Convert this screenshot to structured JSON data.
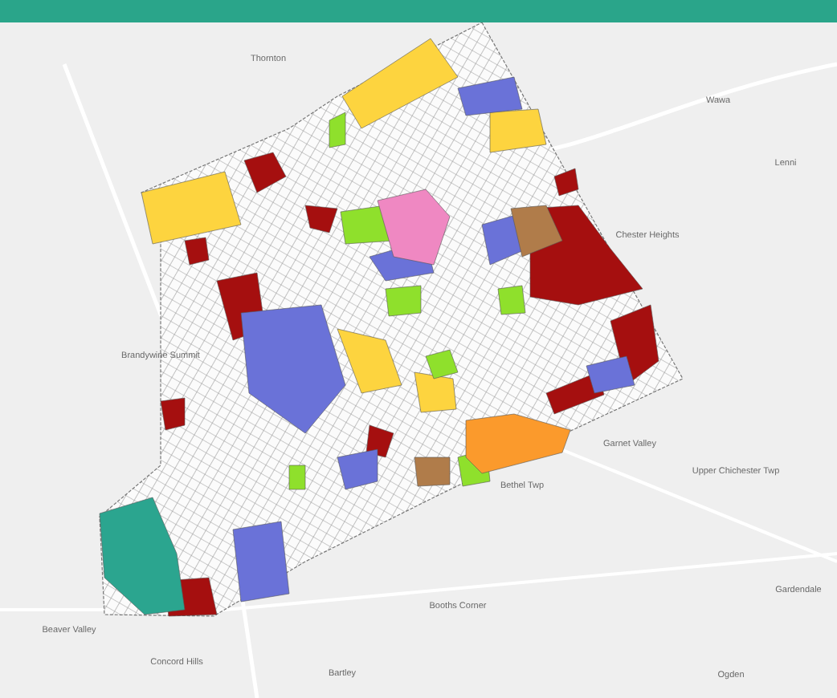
{
  "map": {
    "zones": [
      {
        "kind": "commercial",
        "color": "#a50f0f"
      },
      {
        "kind": "residential_high",
        "color": "#fdd43f"
      },
      {
        "kind": "residential_cluster",
        "color": "#6a72d8"
      },
      {
        "kind": "open_space",
        "color": "#8fe02c"
      },
      {
        "kind": "institutional",
        "color": "#ef88c2"
      },
      {
        "kind": "industrial",
        "color": "#b07c4a"
      },
      {
        "kind": "business_park",
        "color": "#fb9a2c"
      },
      {
        "kind": "preserve",
        "color": "#2ba58f"
      }
    ],
    "place_labels": [
      "Thornton",
      "Wawa",
      "Lenni",
      "Chester Heights",
      "Brandywine Summit",
      "Garnet Valley",
      "Upper Chichester Twp",
      "Bethel Twp",
      "Beaver Valley",
      "Concord Hills",
      "Booths Corner",
      "Bartley",
      "Gardendale",
      "Ogden"
    ]
  }
}
